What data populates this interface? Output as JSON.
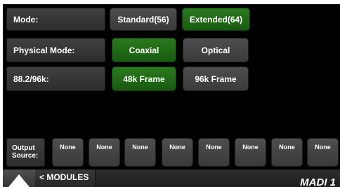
{
  "mode": {
    "label": "Mode:",
    "options": [
      {
        "label": "Standard(56)",
        "selected": false
      },
      {
        "label": "Extended(64)",
        "selected": true
      }
    ]
  },
  "physical_mode": {
    "label": "Physical Mode:",
    "options": [
      {
        "label": "Coaxial",
        "selected": true
      },
      {
        "label": "Optical",
        "selected": false
      }
    ]
  },
  "rate": {
    "label": "88.2/96k:",
    "options": [
      {
        "label": "48k Frame",
        "selected": true
      },
      {
        "label": "96k Frame",
        "selected": false
      }
    ]
  },
  "output_source": {
    "label_line1": "Output",
    "label_line2": "Source:",
    "slots": [
      "None",
      "None",
      "None",
      "None",
      "None",
      "None",
      "None",
      "None"
    ]
  },
  "footer": {
    "home_icon": "triangle-logo-icon",
    "modules_label": "< MODULES",
    "device_name": "MADI 1"
  },
  "colors": {
    "selected": "#1f6a16",
    "unselected": "#444444",
    "background": "#000000"
  }
}
